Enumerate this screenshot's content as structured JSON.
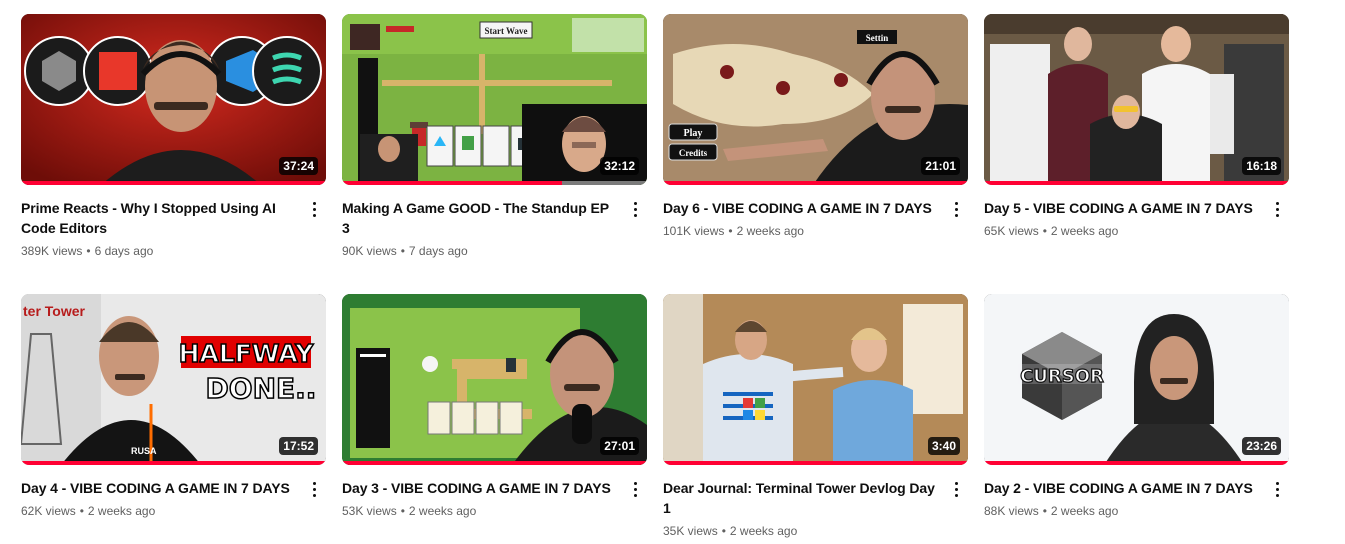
{
  "videos": [
    {
      "title": "Prime Reacts - Why I Stopped Using AI Code Editors",
      "views": "389K views",
      "age": "6 days ago",
      "duration": "37:24",
      "watched": 1.0,
      "thumb_text": ""
    },
    {
      "title": "Making A Game GOOD - The Standup EP 3",
      "views": "90K views",
      "age": "7 days ago",
      "duration": "32:12",
      "watched": 0.72,
      "thumb_text": "Start Wave"
    },
    {
      "title": "Day 6 - VIBE CODING A GAME IN 7 DAYS",
      "views": "101K views",
      "age": "2 weeks ago",
      "duration": "21:01",
      "watched": 1.0,
      "thumb_text": "Play|Credits|Settin"
    },
    {
      "title": "Day 5 - VIBE CODING A GAME IN 7 DAYS",
      "views": "65K views",
      "age": "2 weeks ago",
      "duration": "16:18",
      "watched": 1.0,
      "thumb_text": ""
    },
    {
      "title": "Day 4 - VIBE CODING A GAME IN 7 DAYS",
      "views": "62K views",
      "age": "2 weeks ago",
      "duration": "17:52",
      "watched": 1.0,
      "thumb_text": "HALFWAY|DONE..|ter Tower|RUSA"
    },
    {
      "title": "Day 3 - VIBE CODING A GAME IN 7 DAYS",
      "views": "53K views",
      "age": "2 weeks ago",
      "duration": "27:01",
      "watched": 1.0,
      "thumb_text": ""
    },
    {
      "title": "Dear Journal: Terminal Tower Devlog Day 1",
      "views": "35K views",
      "age": "2 weeks ago",
      "duration": "3:40",
      "watched": 1.0,
      "thumb_text": ""
    },
    {
      "title": "Day 2 - VIBE CODING A GAME IN 7 DAYS",
      "views": "88K views",
      "age": "2 weeks ago",
      "duration": "23:26",
      "watched": 1.0,
      "thumb_text": "CURSOR"
    }
  ],
  "icons": {
    "more": "more-vert-icon"
  },
  "colors": {
    "progress": "#ff0033",
    "stats": "#606060",
    "title": "#0f0f0f"
  }
}
